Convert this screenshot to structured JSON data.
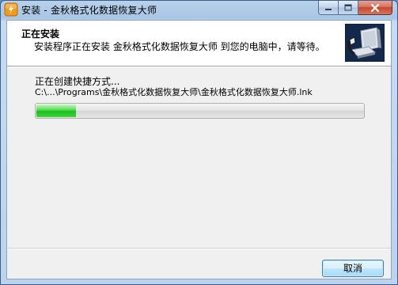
{
  "window": {
    "title": "安装 - 金秋格式化数据恢复大师"
  },
  "header": {
    "title": "正在安装",
    "subtitle": "安装程序正在安装 金秋格式化数据恢复大师 到您的电脑中，请等待。"
  },
  "status": {
    "label": "正在创建快捷方式...",
    "path": "C:\\...\\Programs\\金秋格式化数据恢复大师\\金秋格式化数据恢复大师.lnk"
  },
  "progress": {
    "fraction": 0.12
  },
  "footer": {
    "cancel_label": "取消"
  },
  "colors": {
    "progress_green": "#1dbd1f",
    "title_bar": "#a8c6e6",
    "close_button": "#c7452d"
  },
  "icons": {
    "app": "app-icon",
    "header_logo": "installer-computer-icon",
    "minimize": "minimize-icon",
    "maximize": "maximize-icon",
    "close": "close-icon"
  }
}
